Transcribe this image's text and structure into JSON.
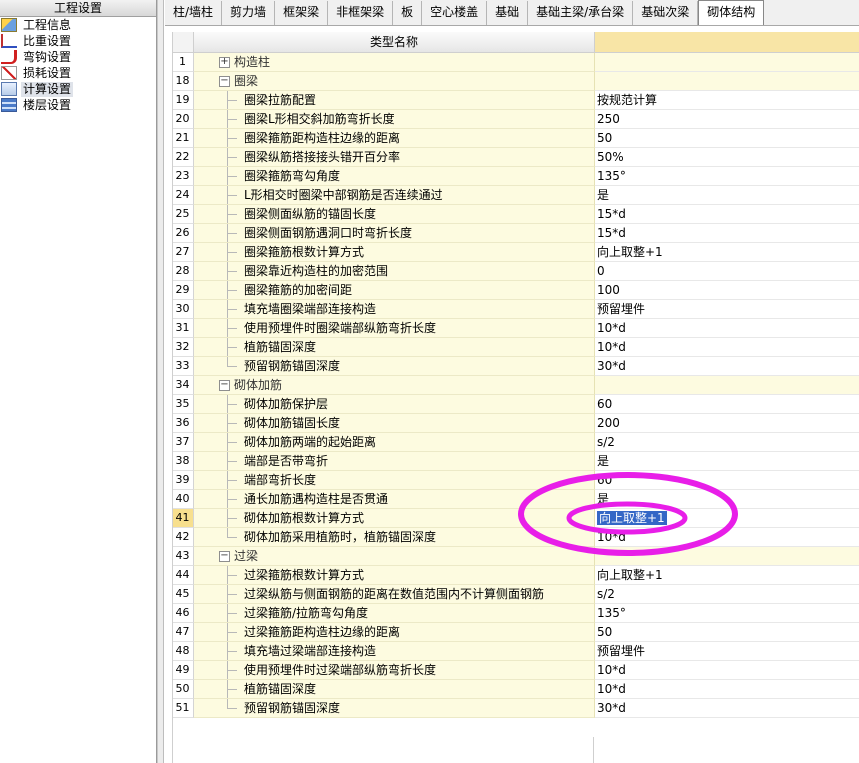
{
  "left_panel": {
    "title": "工程设置",
    "items": [
      {
        "label": "工程信息",
        "icon": "project-info-icon"
      },
      {
        "label": "比重设置",
        "icon": "weight-ratio-icon"
      },
      {
        "label": "弯钩设置",
        "icon": "hook-icon"
      },
      {
        "label": "损耗设置",
        "icon": "loss-icon"
      },
      {
        "label": "计算设置",
        "icon": "calc-settings-icon",
        "selected": true
      },
      {
        "label": "楼层设置",
        "icon": "floor-settings-icon"
      }
    ]
  },
  "tabs": [
    "柱/墙柱",
    "剪力墙",
    "框架梁",
    "非框架梁",
    "板",
    "空心楼盖",
    "基础",
    "基础主梁/承台梁",
    "基础次梁",
    "砌体结构"
  ],
  "active_tab": "砌体结构",
  "grid": {
    "header_name": "类型名称",
    "rows": [
      {
        "num": "1",
        "name": "构造柱",
        "value": "",
        "type": "group",
        "collapsed": true
      },
      {
        "num": "18",
        "name": "圈梁",
        "value": "",
        "type": "group"
      },
      {
        "num": "19",
        "name": "圈梁拉筋配置",
        "value": "按规范计算"
      },
      {
        "num": "20",
        "name": "圈梁L形相交斜加筋弯折长度",
        "value": "250"
      },
      {
        "num": "21",
        "name": "圈梁箍筋距构造柱边缘的距离",
        "value": "50"
      },
      {
        "num": "22",
        "name": "圈梁纵筋搭接接头错开百分率",
        "value": "50%"
      },
      {
        "num": "23",
        "name": "圈梁箍筋弯勾角度",
        "value": "135°"
      },
      {
        "num": "24",
        "name": "L形相交时圈梁中部钢筋是否连续通过",
        "value": "是"
      },
      {
        "num": "25",
        "name": "圈梁侧面纵筋的锚固长度",
        "value": "15*d"
      },
      {
        "num": "26",
        "name": "圈梁侧面钢筋遇洞口时弯折长度",
        "value": "15*d"
      },
      {
        "num": "27",
        "name": "圈梁箍筋根数计算方式",
        "value": "向上取整+1"
      },
      {
        "num": "28",
        "name": "圈梁靠近构造柱的加密范围",
        "value": "0"
      },
      {
        "num": "29",
        "name": "圈梁箍筋的加密间距",
        "value": "100"
      },
      {
        "num": "30",
        "name": "填充墙圈梁端部连接构造",
        "value": "预留埋件"
      },
      {
        "num": "31",
        "name": "使用预埋件时圈梁端部纵筋弯折长度",
        "value": "10*d"
      },
      {
        "num": "32",
        "name": "植筋锚固深度",
        "value": "10*d"
      },
      {
        "num": "33",
        "name": "预留钢筋锚固深度",
        "value": "30*d",
        "last": true
      },
      {
        "num": "34",
        "name": "砌体加筋",
        "value": "",
        "type": "group"
      },
      {
        "num": "35",
        "name": "砌体加筋保护层",
        "value": "60"
      },
      {
        "num": "36",
        "name": "砌体加筋锚固长度",
        "value": "200"
      },
      {
        "num": "37",
        "name": "砌体加筋两端的起始距离",
        "value": "s/2"
      },
      {
        "num": "38",
        "name": "端部是否带弯折",
        "value": "是"
      },
      {
        "num": "39",
        "name": "端部弯折长度",
        "value": "60"
      },
      {
        "num": "40",
        "name": "通长加筋遇构造柱是否贯通",
        "value": "是"
      },
      {
        "num": "41",
        "name": "砌体加筋根数计算方式",
        "value": "向上取整+1",
        "current": true
      },
      {
        "num": "42",
        "name": "砌体加筋采用植筋时，植筋锚固深度",
        "value": "10*d",
        "last": true
      },
      {
        "num": "43",
        "name": "过梁",
        "value": "",
        "type": "group"
      },
      {
        "num": "44",
        "name": "过梁箍筋根数计算方式",
        "value": "向上取整+1"
      },
      {
        "num": "45",
        "name": "过梁纵筋与侧面钢筋的距离在数值范围内不计算侧面钢筋",
        "value": "s/2"
      },
      {
        "num": "46",
        "name": "过梁箍筋/拉筋弯勾角度",
        "value": "135°"
      },
      {
        "num": "47",
        "name": "过梁箍筋距构造柱边缘的距离",
        "value": "50"
      },
      {
        "num": "48",
        "name": "填充墙过梁端部连接构造",
        "value": "预留埋件"
      },
      {
        "num": "49",
        "name": "使用预埋件时过梁端部纵筋弯折长度",
        "value": "10*d"
      },
      {
        "num": "50",
        "name": "植筋锚固深度",
        "value": "10*d"
      },
      {
        "num": "51",
        "name": "预留钢筋锚固深度",
        "value": "30*d",
        "last": true
      }
    ]
  },
  "colors": {
    "annotation": "#e81ee8",
    "selection": "#3467c6",
    "header_value_bg": "#f8e5a6",
    "name_cell_bg": "#fdfbe0"
  }
}
